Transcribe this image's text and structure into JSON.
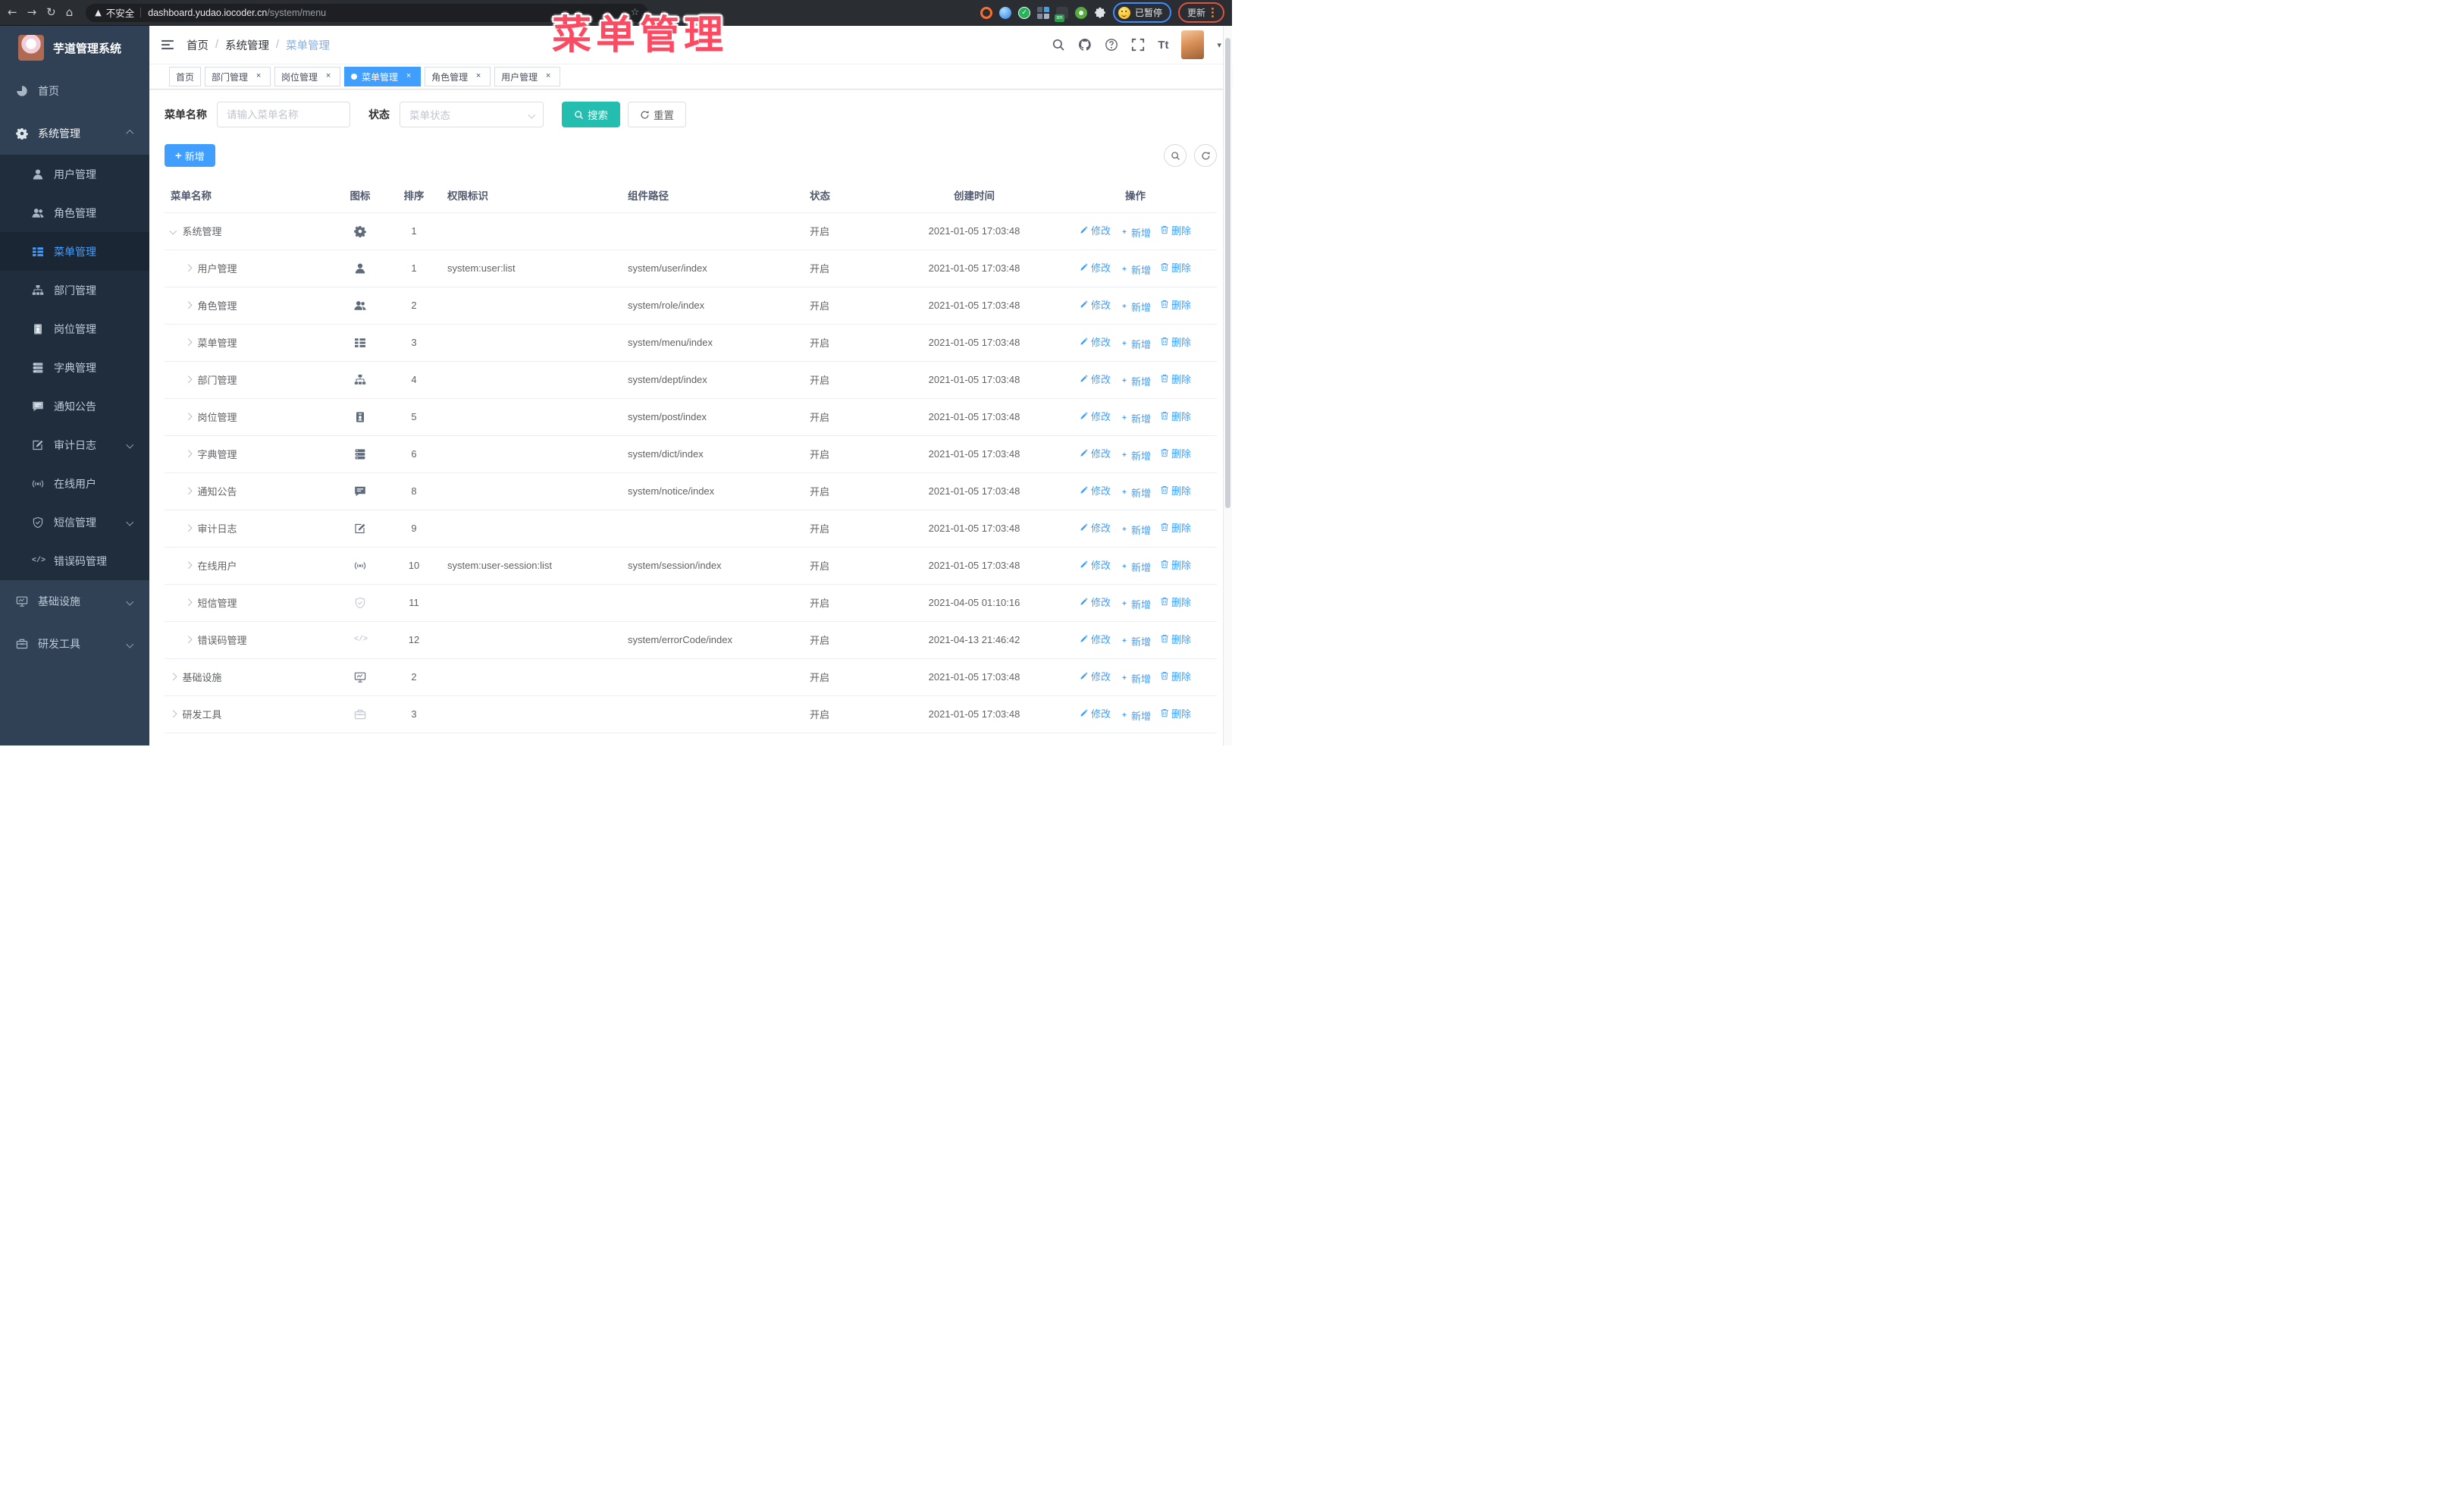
{
  "browser": {
    "security_label": "不安全",
    "url_domain": "dashboard.yudao.iocoder.cn",
    "url_path": "/system/menu",
    "on_badge": "on",
    "paused_label": "已暂停",
    "update_label": "更新"
  },
  "annotation_text": "菜单管理",
  "colors": {
    "primary": "#409eff",
    "search_teal": "#23beb0",
    "annotation_pink": "#fb4b63",
    "sidebar_bg": "#304156",
    "submenu_bg": "#1f2d3d"
  },
  "sidebar": {
    "logo_title": "芋道管理系统",
    "menu": [
      {
        "label": "首页",
        "icon": "dashboard",
        "type": "top"
      },
      {
        "label": "系统管理",
        "icon": "gear",
        "type": "top",
        "active": true,
        "arrow": "up",
        "children": [
          {
            "label": "用户管理",
            "icon": "user"
          },
          {
            "label": "角色管理",
            "icon": "users"
          },
          {
            "label": "菜单管理",
            "icon": "tree-table",
            "selected": true
          },
          {
            "label": "部门管理",
            "icon": "org-tree"
          },
          {
            "label": "岗位管理",
            "icon": "badge"
          },
          {
            "label": "字典管理",
            "icon": "dict"
          },
          {
            "label": "通知公告",
            "icon": "message"
          },
          {
            "label": "审计日志",
            "icon": "edit",
            "arrow": "down"
          },
          {
            "label": "在线用户",
            "icon": "online"
          },
          {
            "label": "短信管理",
            "icon": "shield",
            "arrow": "down"
          },
          {
            "label": "错误码管理",
            "icon": "code"
          }
        ]
      },
      {
        "label": "基础设施",
        "icon": "monitor",
        "type": "top",
        "arrow": "down"
      },
      {
        "label": "研发工具",
        "icon": "toolbox",
        "type": "top",
        "arrow": "down"
      }
    ]
  },
  "navbar": {
    "breadcrumb": [
      "首页",
      "系统管理",
      "菜单管理"
    ]
  },
  "tags": [
    {
      "label": "首页",
      "closable": false,
      "active": false
    },
    {
      "label": "部门管理",
      "closable": true,
      "active": false
    },
    {
      "label": "岗位管理",
      "closable": true,
      "active": false
    },
    {
      "label": "菜单管理",
      "closable": true,
      "active": true
    },
    {
      "label": "角色管理",
      "closable": true,
      "active": false
    },
    {
      "label": "用户管理",
      "closable": true,
      "active": false
    }
  ],
  "filters": {
    "name_label": "菜单名称",
    "name_placeholder": "请输入菜单名称",
    "name_value": "",
    "status_label": "状态",
    "status_placeholder": "菜单状态",
    "search_label": "搜索",
    "reset_label": "重置"
  },
  "toolbar": {
    "add_label": "新增"
  },
  "table": {
    "columns": [
      "菜单名称",
      "图标",
      "排序",
      "权限标识",
      "组件路径",
      "状态",
      "创建时间",
      "操作"
    ],
    "ops": {
      "edit": "修改",
      "add": "新增",
      "del": "删除"
    },
    "rows": [
      {
        "name": "系统管理",
        "level": 1,
        "arrow": "down",
        "icon": "gear",
        "sort": "1",
        "perm": "",
        "path": "",
        "status": "开启",
        "time": "2021-01-05 17:03:48"
      },
      {
        "name": "用户管理",
        "level": 2,
        "arrow": "right",
        "icon": "user",
        "sort": "1",
        "perm": "system:user:list",
        "path": "system/user/index",
        "status": "开启",
        "time": "2021-01-05 17:03:48"
      },
      {
        "name": "角色管理",
        "level": 2,
        "arrow": "right",
        "icon": "users",
        "sort": "2",
        "perm": "",
        "path": "system/role/index",
        "status": "开启",
        "time": "2021-01-05 17:03:48"
      },
      {
        "name": "菜单管理",
        "level": 2,
        "arrow": "right",
        "icon": "tree-table",
        "sort": "3",
        "perm": "",
        "path": "system/menu/index",
        "status": "开启",
        "time": "2021-01-05 17:03:48"
      },
      {
        "name": "部门管理",
        "level": 2,
        "arrow": "right",
        "icon": "org-tree",
        "sort": "4",
        "perm": "",
        "path": "system/dept/index",
        "status": "开启",
        "time": "2021-01-05 17:03:48"
      },
      {
        "name": "岗位管理",
        "level": 2,
        "arrow": "right",
        "icon": "badge",
        "sort": "5",
        "perm": "",
        "path": "system/post/index",
        "status": "开启",
        "time": "2021-01-05 17:03:48"
      },
      {
        "name": "字典管理",
        "level": 2,
        "arrow": "right",
        "icon": "dict",
        "sort": "6",
        "perm": "",
        "path": "system/dict/index",
        "status": "开启",
        "time": "2021-01-05 17:03:48"
      },
      {
        "name": "通知公告",
        "level": 2,
        "arrow": "right",
        "icon": "message",
        "sort": "8",
        "perm": "",
        "path": "system/notice/index",
        "status": "开启",
        "time": "2021-01-05 17:03:48"
      },
      {
        "name": "审计日志",
        "level": 2,
        "arrow": "right",
        "icon": "edit",
        "sort": "9",
        "perm": "",
        "path": "",
        "status": "开启",
        "time": "2021-01-05 17:03:48"
      },
      {
        "name": "在线用户",
        "level": 2,
        "arrow": "right",
        "icon": "online",
        "sort": "10",
        "perm": "system:user-session:list",
        "path": "system/session/index",
        "status": "开启",
        "time": "2021-01-05 17:03:48"
      },
      {
        "name": "短信管理",
        "level": 2,
        "arrow": "right",
        "icon": "shield",
        "icon_light": true,
        "sort": "11",
        "perm": "",
        "path": "",
        "status": "开启",
        "time": "2021-04-05 01:10:16"
      },
      {
        "name": "错误码管理",
        "level": 2,
        "arrow": "right",
        "icon": "code",
        "icon_light": true,
        "sort": "12",
        "perm": "",
        "path": "system/errorCode/index",
        "status": "开启",
        "time": "2021-04-13 21:46:42"
      },
      {
        "name": "基础设施",
        "level": 1,
        "arrow": "right",
        "icon": "monitor",
        "sort": "2",
        "perm": "",
        "path": "",
        "status": "开启",
        "time": "2021-01-05 17:03:48"
      },
      {
        "name": "研发工具",
        "level": 1,
        "arrow": "right",
        "icon": "toolbox",
        "icon_light": true,
        "sort": "3",
        "perm": "",
        "path": "",
        "status": "开启",
        "time": "2021-01-05 17:03:48"
      }
    ]
  }
}
